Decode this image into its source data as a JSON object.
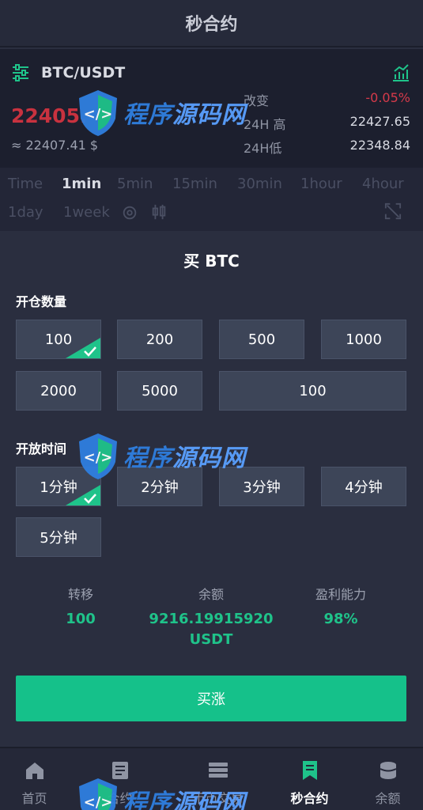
{
  "header": {
    "title": "秒合约"
  },
  "ticker": {
    "pair": "BTC/USDT",
    "price": "22405.",
    "approx": "≈ 22407.41 $",
    "stats": [
      {
        "label": "改变",
        "value": "-0.05%"
      },
      {
        "label": "24H 高",
        "value": "22427.65"
      },
      {
        "label": "24H低",
        "value": "22348.84"
      }
    ]
  },
  "periods": {
    "items": [
      "Time",
      "1min",
      "5min",
      "15min",
      "30min",
      "1hour",
      "4hour",
      "1day",
      "1week"
    ],
    "active": "1min"
  },
  "panel": {
    "title": "买 BTC",
    "amount_label": "开仓数量",
    "amounts": [
      "100",
      "200",
      "500",
      "1000",
      "2000",
      "5000"
    ],
    "amount_input_value": "100",
    "time_label": "开放时间",
    "times": [
      "1分钟",
      "2分钟",
      "3分钟",
      "4分钟",
      "5分钟"
    ],
    "info": [
      {
        "label": "转移",
        "value": "100"
      },
      {
        "label": "余额",
        "value": "9216.19915920 USDT"
      },
      {
        "label": "盈利能力",
        "value": "98%"
      }
    ],
    "buy_label": "买涨"
  },
  "tabs": [
    {
      "label": "首页",
      "icon": "home-icon"
    },
    {
      "label": "合约",
      "icon": "document-icon"
    },
    {
      "label": "币币交易",
      "icon": "stack-icon"
    },
    {
      "label": "秒合约",
      "icon": "bookmark-icon",
      "active": true
    },
    {
      "label": "余额",
      "icon": "wallet-icon"
    }
  ],
  "watermark": {
    "text_a": "程序",
    "text_b": "源码网"
  },
  "colors": {
    "accent": "#15c18a",
    "negative": "#d63a4a",
    "background": "#2a2e3f"
  }
}
